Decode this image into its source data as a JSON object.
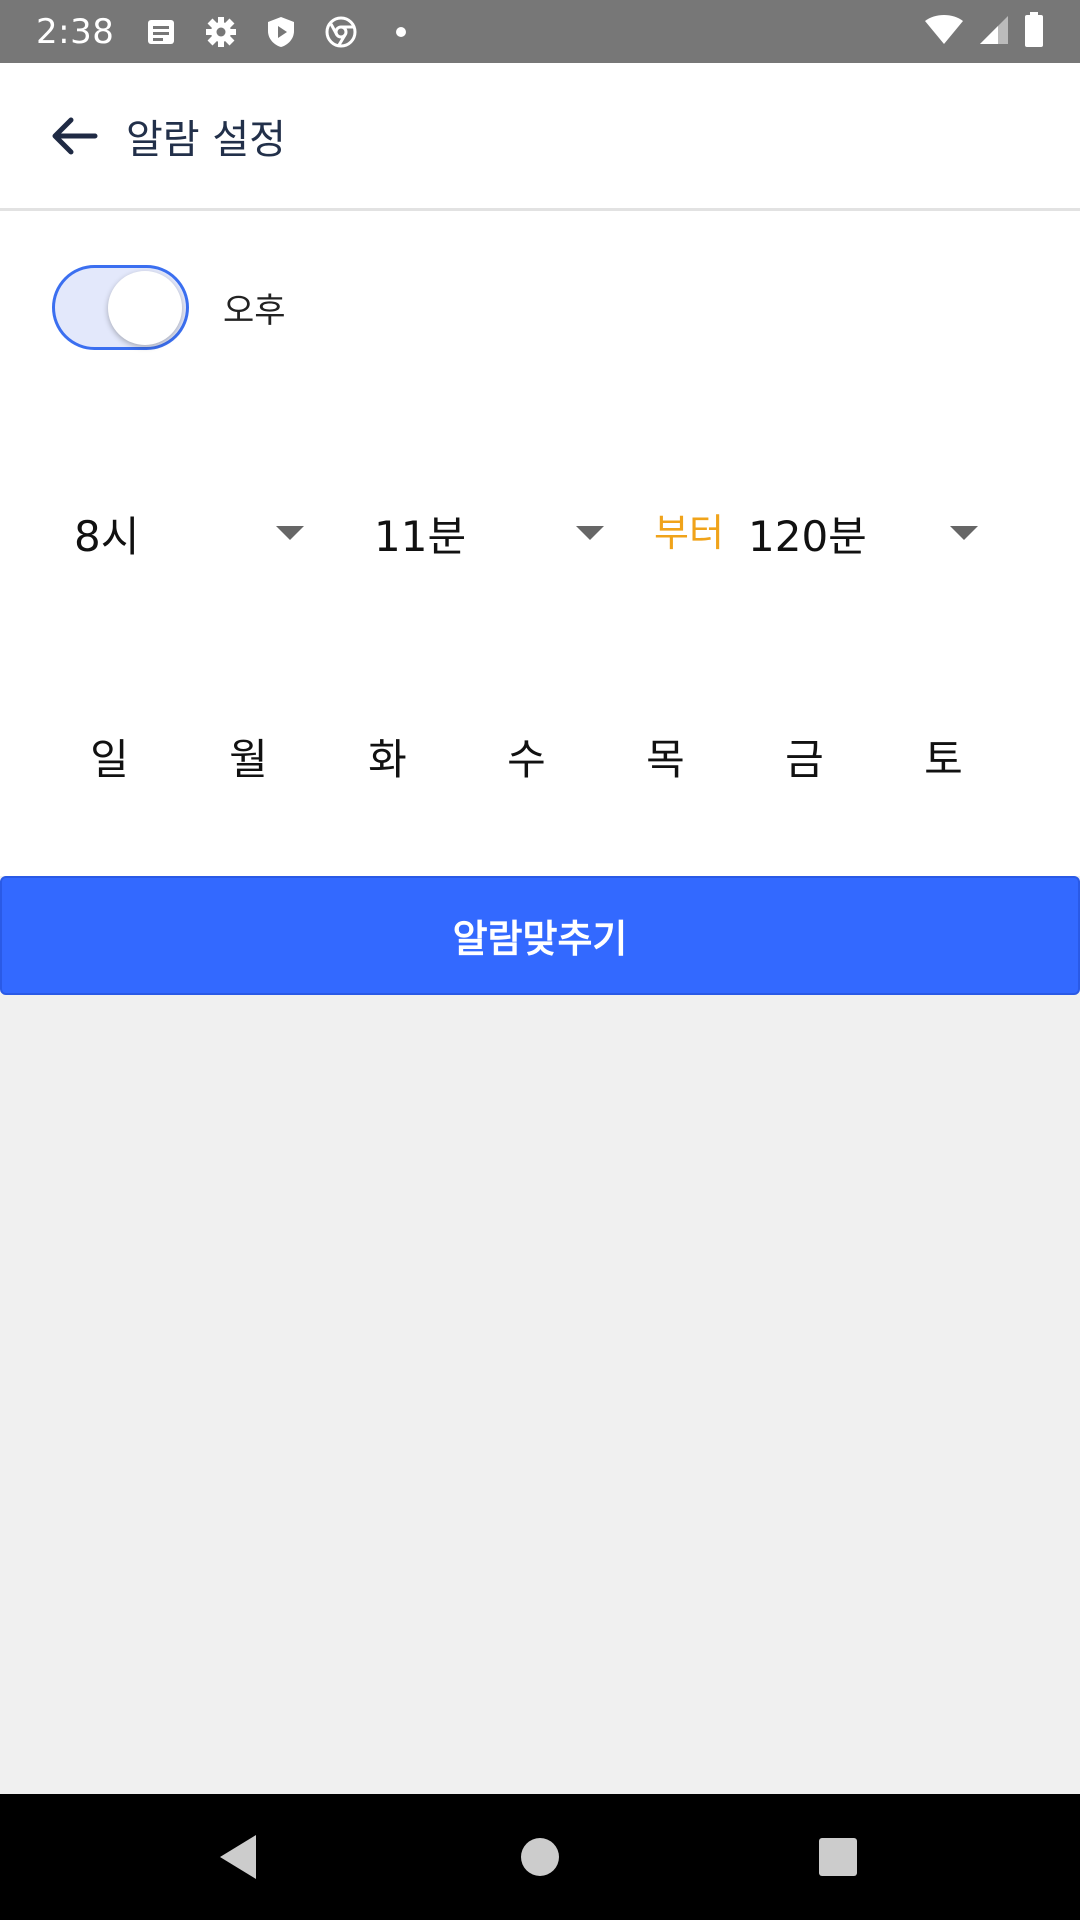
{
  "status_bar": {
    "time": "2:38",
    "icons": [
      "notes-icon",
      "settings-icon",
      "shield-play-icon",
      "chrome-icon",
      "dot-icon",
      "wifi-icon",
      "signal-icon",
      "battery-icon"
    ]
  },
  "app_bar": {
    "title": "알람 설정"
  },
  "ampm_toggle": {
    "label": "오후",
    "on": true
  },
  "time_selection": {
    "hour": "8시",
    "minute": "11분",
    "from_label": "부터",
    "duration": "120분"
  },
  "weekdays": [
    "일",
    "월",
    "화",
    "수",
    "목",
    "금",
    "토"
  ],
  "alarm_button": {
    "label": "알람맞추기"
  },
  "colors": {
    "accent": "#3369ff",
    "from_label": "#f0a31a",
    "toggle_track": "#e3e8fb"
  }
}
